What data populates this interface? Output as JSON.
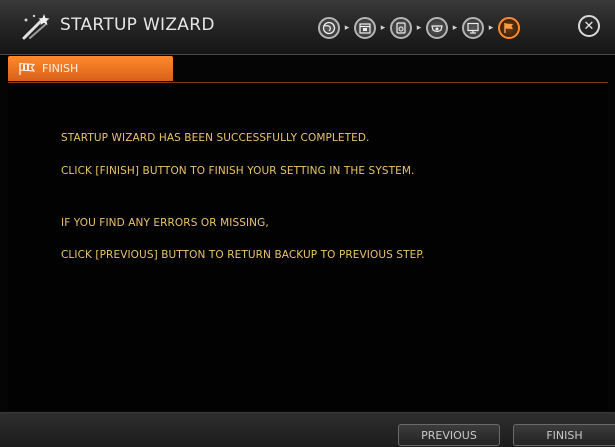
{
  "window": {
    "title": "STARTUP WIZARD",
    "title_icon": "wizard-wand-icon",
    "close_icon": "close-icon",
    "close_glyph": "✕"
  },
  "steps": [
    {
      "icon": "language-globe-icon",
      "state": "done"
    },
    {
      "icon": "calendar-icon",
      "state": "done"
    },
    {
      "icon": "hdd-storage-icon",
      "state": "done"
    },
    {
      "icon": "camera-icon",
      "state": "done"
    },
    {
      "icon": "network-monitor-icon",
      "state": "done"
    },
    {
      "icon": "finish-flag-icon",
      "state": "active"
    }
  ],
  "step_separator": "▸",
  "tab": {
    "label": "FINISH",
    "icon": "finish-flag-icon"
  },
  "messages": [
    "STARTUP WIZARD HAS BEEN SUCCESSFULLY COMPLETED.",
    "CLICK [FINISH] BUTTON TO FINISH YOUR SETTING IN THE SYSTEM.",
    "IF YOU FIND ANY ERRORS OR MISSING,",
    "CLICK [PREVIOUS] BUTTON TO RETURN BACKUP TO PREVIOUS STEP."
  ],
  "buttons": {
    "previous": "PREVIOUS",
    "finish": "FINISH"
  },
  "colors": {
    "accent": "#ff8a2c",
    "message_text": "#e9c46a",
    "background": "#050505"
  }
}
